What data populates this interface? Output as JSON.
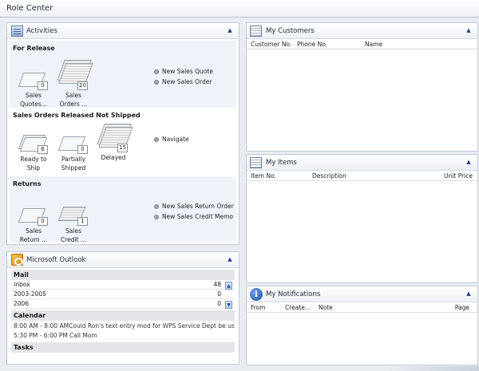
{
  "window": {
    "title": "Role Center"
  },
  "activities": {
    "title": "Activities",
    "sections": [
      {
        "title": "For Release",
        "cues": [
          {
            "label1": "Sales",
            "label2": "Quotes...",
            "count": "0"
          },
          {
            "label1": "Sales",
            "label2": "Orders ...",
            "count": "20"
          }
        ],
        "actions": [
          "New Sales Quote",
          "New Sales Order"
        ]
      },
      {
        "title": "Sales Orders Released Not Shipped",
        "cues": [
          {
            "label1": "Ready to",
            "label2": "Ship",
            "count": "6"
          },
          {
            "label1": "Partially",
            "label2": "Shipped",
            "count": "0"
          },
          {
            "label1": "Delayed",
            "label2": "",
            "count": "15"
          }
        ],
        "actions": [
          "Navigate"
        ]
      },
      {
        "title": "Returns",
        "cues": [
          {
            "label1": "Sales",
            "label2": "Return ...",
            "count": "0"
          },
          {
            "label1": "Sales",
            "label2": "Credit ...",
            "count": "1"
          }
        ],
        "actions": [
          "New Sales Return Order",
          "New Sales Credit Memo"
        ]
      }
    ]
  },
  "outlook": {
    "title": "Microsoft Outlook",
    "mail_header": "Mail",
    "mail": [
      {
        "name": "Inbox",
        "count": "48"
      },
      {
        "name": "2003-2005",
        "count": "0"
      },
      {
        "name": "2006",
        "count": "0"
      }
    ],
    "calendar_header": "Calendar",
    "calendar": [
      {
        "time": "8:00 AM - 8:00 AM",
        "subject": "Could Ron's text entry mod for WPS Service Dept be us..."
      },
      {
        "time": "5:30 PM - 6:00 PM",
        "subject": "Call Mom"
      }
    ],
    "tasks_header": "Tasks"
  },
  "my_customers": {
    "title": "My Customers",
    "columns": [
      "Customer No.",
      "Phone No.",
      "Name"
    ]
  },
  "my_items": {
    "title": "My Items",
    "columns": [
      "Item No.",
      "Description",
      "Unit Price"
    ]
  },
  "my_notifications": {
    "title": "My Notifications",
    "columns": [
      "From",
      "Create...",
      "Note",
      "Page"
    ]
  },
  "icons": {
    "collapse": "chevron-up-icon",
    "scroll_up": "scroll-up-icon",
    "scroll_down": "scroll-down-icon"
  },
  "colors": {
    "accent": "#1d3f86",
    "activities_bg": "#eef3fa",
    "window_bg": "#e9edf2"
  }
}
